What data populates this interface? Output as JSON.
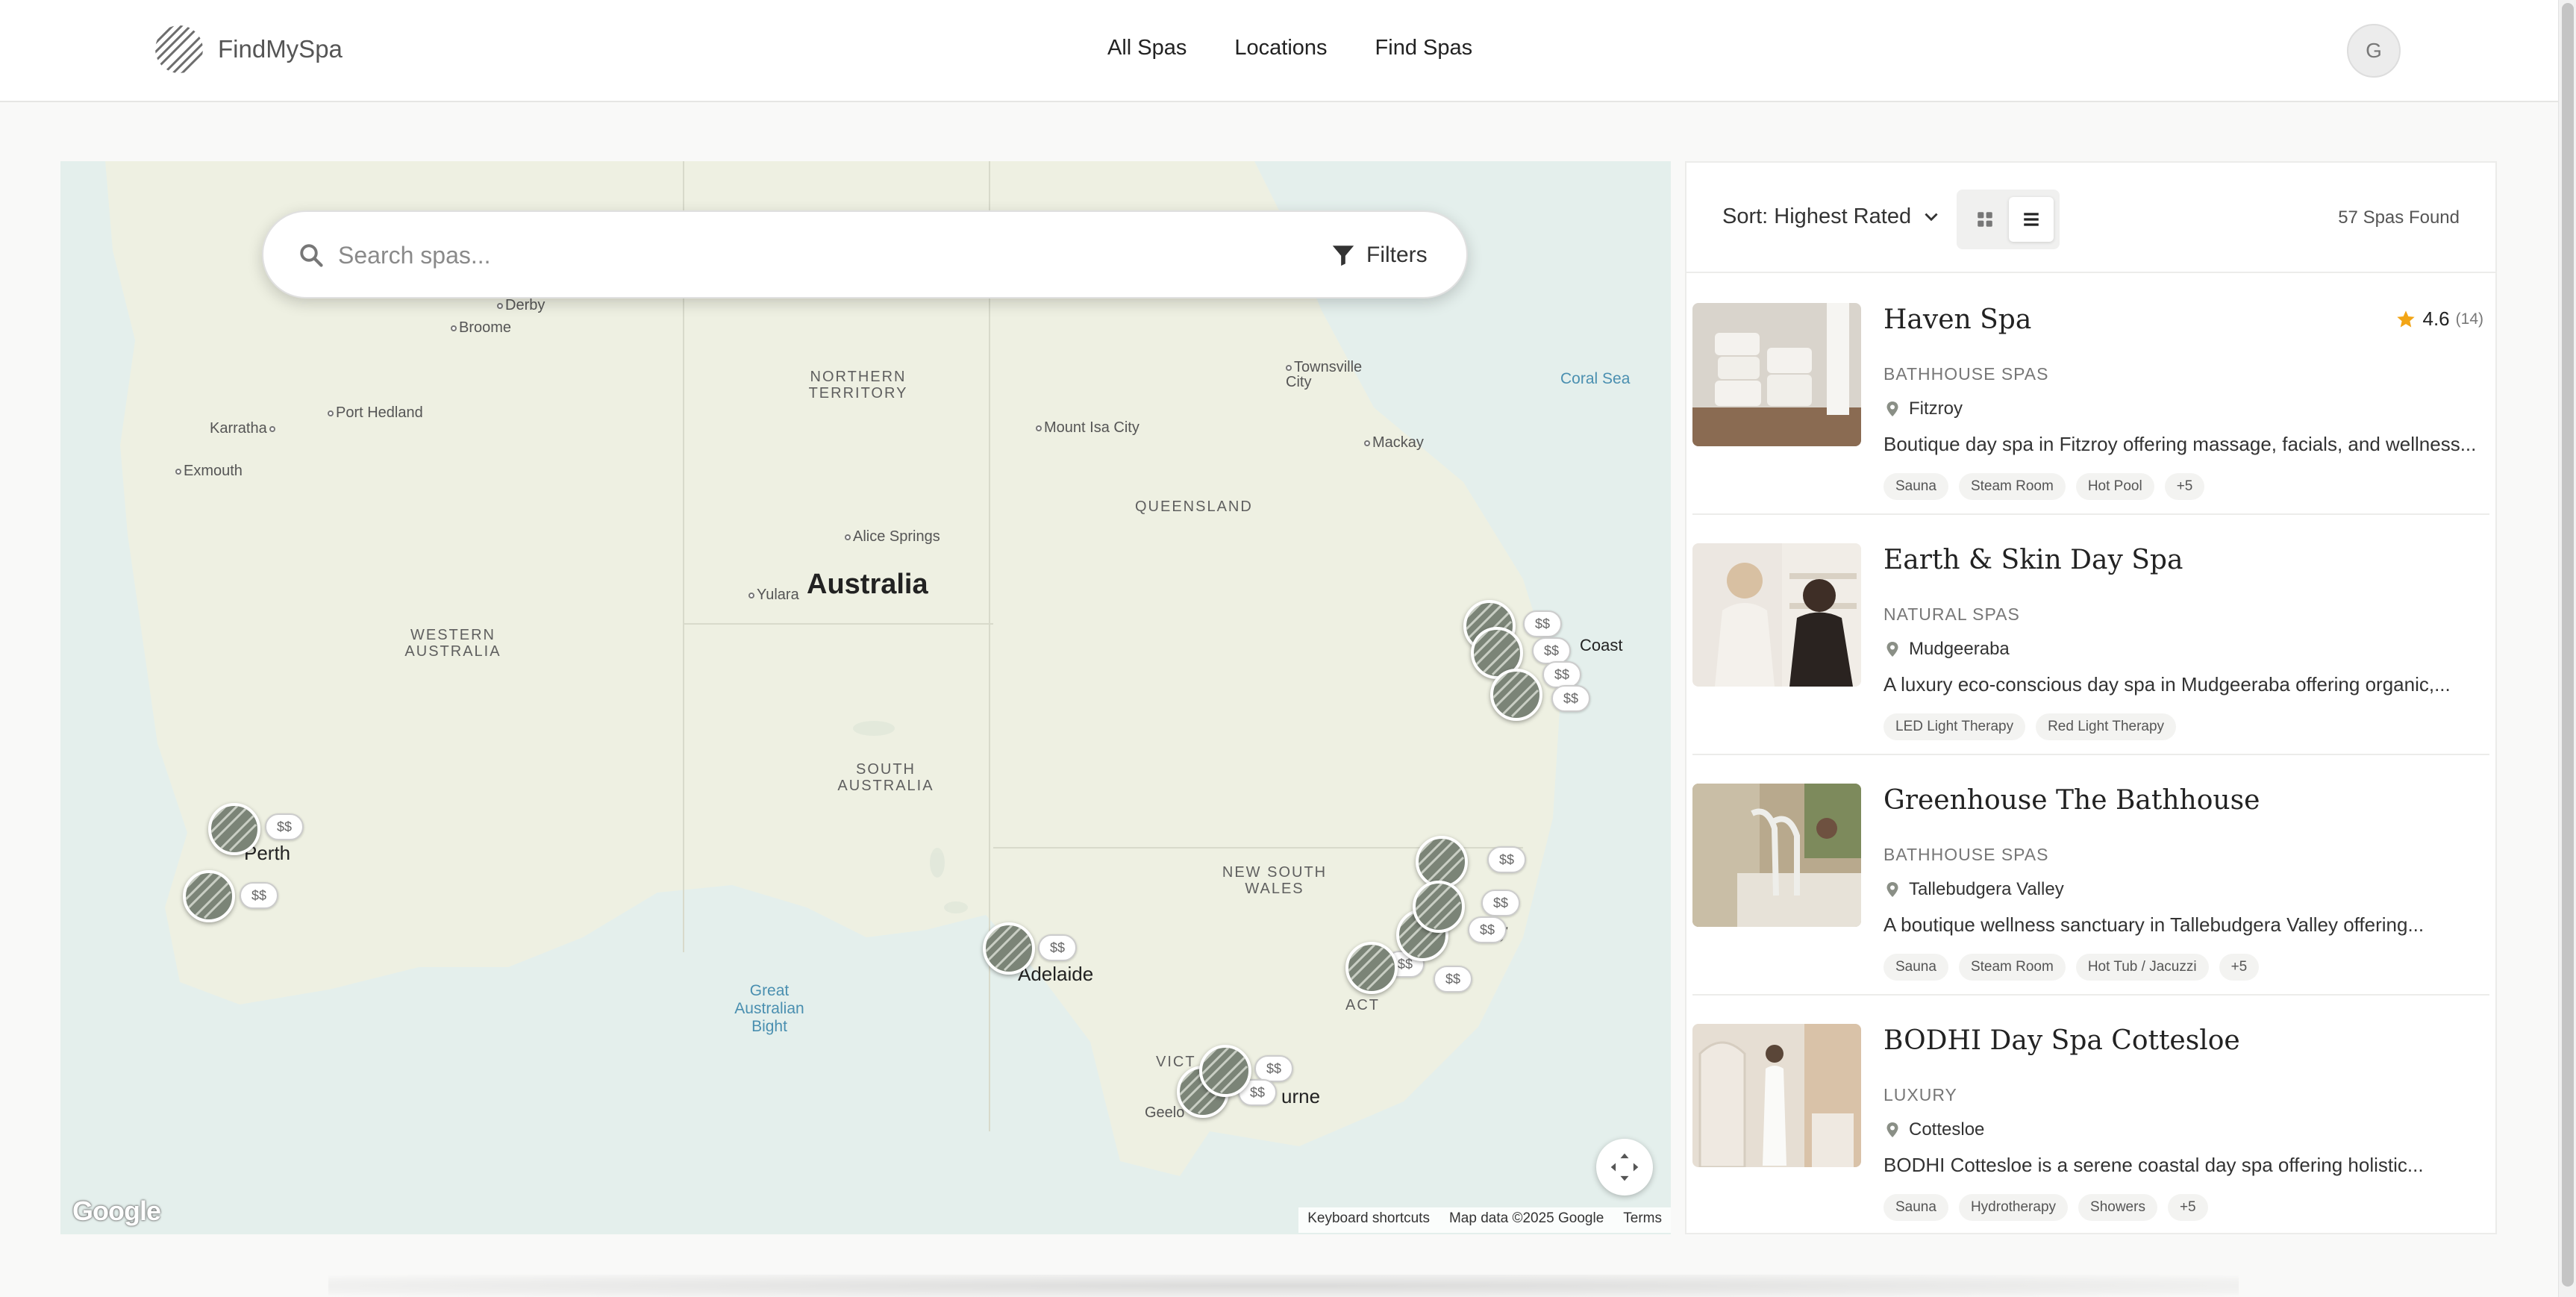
{
  "header": {
    "brand": "FindMySpa",
    "nav": [
      "All Spas",
      "Locations",
      "Find Spas"
    ],
    "avatar_initial": "G"
  },
  "search": {
    "placeholder": "Search spas...",
    "filters_label": "Filters"
  },
  "map": {
    "country": "Australia",
    "regions": [
      "NORTHERN TERRITORY",
      "QUEENSLAND",
      "WESTERN AUSTRALIA",
      "SOUTH AUSTRALIA",
      "NEW SOUTH WALES",
      "ACT",
      "VICT"
    ],
    "cities": [
      "Derby",
      "Broome",
      "Port Hedland",
      "Karratha",
      "Exmouth",
      "Alice Springs",
      "Yulara",
      "Mount Isa City",
      "Townsville City",
      "Mackay",
      "Geelo"
    ],
    "major_cities": [
      "Perth",
      "Adelaide",
      "urne",
      "ey",
      "Coast"
    ],
    "water": [
      "Coral Sea",
      "Great Australian Bight"
    ],
    "price_label": "$$",
    "google_logo": "Google",
    "attribution": {
      "shortcuts": "Keyboard shortcuts",
      "data": "Map data ©2025 Google",
      "terms": "Terms"
    }
  },
  "results": {
    "sort_label": "Sort: Highest Rated",
    "count_label": "57 Spas Found",
    "cards": [
      {
        "title": "Haven Spa",
        "rating": "4.6",
        "reviews": "(14)",
        "category": "BATHHOUSE SPAS",
        "location": "Fitzroy",
        "description": "Boutique day spa in Fitzroy offering massage, facials, and wellness...",
        "tags": [
          "Sauna",
          "Steam Room",
          "Hot Pool",
          "+5"
        ]
      },
      {
        "title": "Earth & Skin Day Spa",
        "category": "NATURAL SPAS",
        "location": "Mudgeeraba",
        "description": "A luxury eco-conscious day spa in Mudgeeraba offering organic,...",
        "tags": [
          "LED Light Therapy",
          "Red Light Therapy"
        ]
      },
      {
        "title": "Greenhouse The Bathhouse",
        "category": "BATHHOUSE SPAS",
        "location": "Tallebudgera Valley",
        "description": "A boutique wellness sanctuary in Tallebudgera Valley offering...",
        "tags": [
          "Sauna",
          "Steam Room",
          "Hot Tub / Jacuzzi",
          "+5"
        ]
      },
      {
        "title": "BODHI Day Spa Cottesloe",
        "category": "LUXURY",
        "location": "Cottesloe",
        "description": "BODHI Cottesloe is a serene coastal day spa offering holistic...",
        "tags": [
          "Sauna",
          "Hydrotherapy",
          "Showers",
          "+5"
        ]
      }
    ]
  },
  "colors": {
    "marker": "#7b8477",
    "star": "#f2a516",
    "land": "#eef0e2",
    "water": "#e4efec"
  }
}
